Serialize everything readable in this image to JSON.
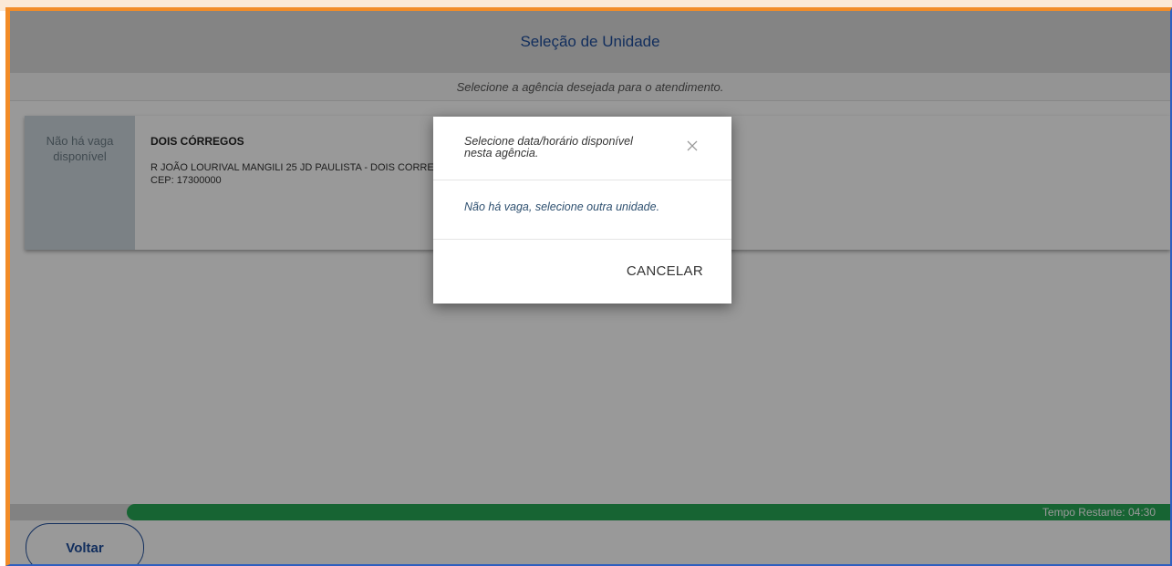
{
  "header": {
    "title": "Seleção de Unidade"
  },
  "subheader": {
    "text": "Selecione a agência desejada para o atendimento."
  },
  "unit_card": {
    "status": "Não há vaga disponível",
    "name": "DOIS CÓRREGOS",
    "address": "R JOÃO LOURIVAL MANGILI 25 JD PAULISTA - DOIS CORREGOS",
    "cep": "CEP: 17300000"
  },
  "timer": {
    "label": "Tempo Restante: 04:30"
  },
  "footer": {
    "back_label": "Voltar"
  },
  "modal": {
    "title": "Selecione data/horário disponível nesta agência.",
    "message": "Não há vaga, selecione outra unidade.",
    "cancel_label": "CANCELAR"
  },
  "colors": {
    "frame_orange": "#f28c28",
    "accent_blue": "#1f4e9c",
    "progress_green": "#27a755",
    "status_bg": "#ced8de"
  },
  "icons": {
    "close": "close-icon"
  }
}
